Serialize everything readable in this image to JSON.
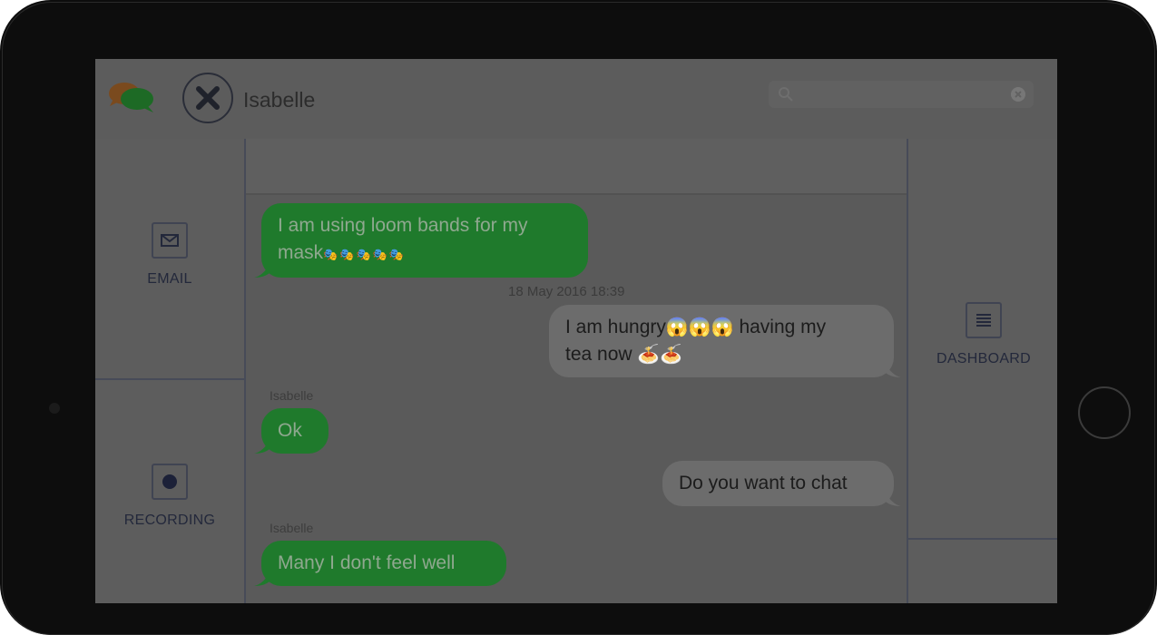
{
  "header": {
    "contact_name": "Isabelle",
    "search_placeholder": ""
  },
  "sidebar_left": {
    "items": [
      {
        "label": "EMAIL",
        "icon": "envelope-icon"
      },
      {
        "label": "RECORDING",
        "icon": "record-icon"
      }
    ]
  },
  "sidebar_right": {
    "items": [
      {
        "label": "DASHBOARD",
        "icon": "menu-lines-icon"
      }
    ]
  },
  "conversation": {
    "messages": [
      {
        "direction": "incoming",
        "line1": "I am using loom bands for my",
        "line2": "mask",
        "emoji": "🎭🎭🎭🎭🎭"
      },
      {
        "timestamp": "18 May 2016 18:39"
      },
      {
        "direction": "outgoing",
        "line1": "I am hungry",
        "emoji1": "😱😱😱",
        "line1b": " having my",
        "line2": "tea now ",
        "emoji2": "🍝🍝"
      },
      {
        "sender": "Isabelle",
        "direction": "incoming",
        "text": "Ok"
      },
      {
        "direction": "outgoing",
        "text": "Do you want to chat"
      },
      {
        "sender": "Isabelle",
        "direction": "incoming",
        "text": "Many I don't feel well"
      }
    ]
  },
  "colors": {
    "incoming_bubble": "#1f7a2c",
    "outgoing_bubble": "#6c6c6c",
    "accent_navy": "#23283b"
  }
}
